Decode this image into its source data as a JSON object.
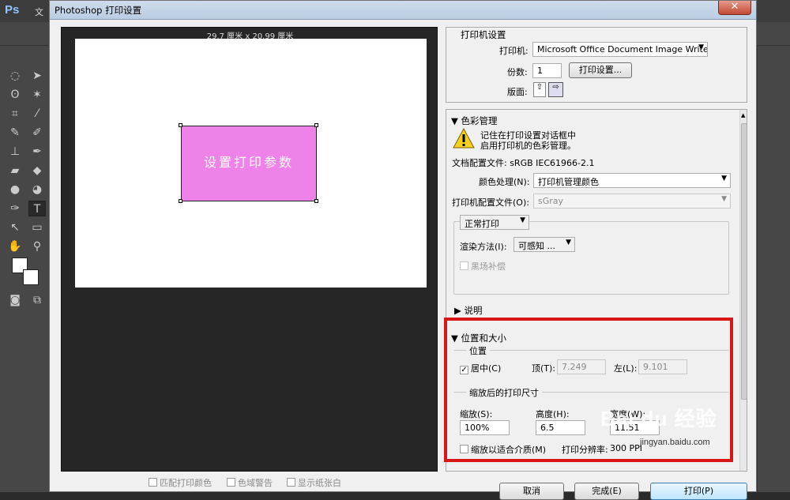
{
  "app": {
    "logo": "Ps",
    "menu_first": "文"
  },
  "dialog": {
    "title": "Photoshop 打印设置",
    "close": "✕",
    "preview": {
      "paper_size": "29.7 厘米 x 20.99 厘米",
      "image_text": "设置打印参数"
    },
    "bottom_options": [
      "匹配打印颜色",
      "色域警告",
      "显示纸张白"
    ],
    "printer_setup": {
      "heading": "打印机设置",
      "printer_label": "打印机:",
      "printer_value": "Microsoft Office Document Image Writer",
      "copies_label": "份数:",
      "copies_value": "1",
      "setup_button": "打印设置...",
      "layout_label": "版面:"
    },
    "color_mgmt": {
      "heading": "色彩管理",
      "warning_line1": "记住在打印设置对话框中",
      "warning_line2": "启用打印机的色彩管理。",
      "doc_profile": "文档配置文件: sRGB IEC61966-2.1",
      "handling_label": "颜色处理(N):",
      "handling_value": "打印机管理颜色",
      "printer_profile_label": "打印机配置文件(O):",
      "printer_profile_value": "sGray",
      "print_mode": "正常打印",
      "intent_label": "渲染方法(I):",
      "intent_value": "可感知",
      "intent_dots": "...",
      "bpc_label": "黑场补偿"
    },
    "description": {
      "heading": "说明"
    },
    "position_size": {
      "heading": "位置和大小",
      "position_legend": "位置",
      "center_label": "居中(C)",
      "center_checked": true,
      "top_label": "顶(T):",
      "top_value": "7.249",
      "left_label": "左(L):",
      "left_value": "9.101",
      "scaled_legend": "缩放后的打印尺寸",
      "scale_label": "缩放(S):",
      "scale_value": "100%",
      "height_label": "高度(H):",
      "height_value": "6.5",
      "width_label": "宽度(W):",
      "width_value": "11.51",
      "fit_media_label": "缩放以适合介质(M)",
      "resolution_label": "打印分辨率:",
      "resolution_value": "300 PPI"
    },
    "footer": {
      "cancel": "取消",
      "done": "完成(E)",
      "print": "打印(P)"
    }
  },
  "watermark": {
    "logo": "Bai du 经验",
    "url": "jingyan.baidu.com"
  }
}
